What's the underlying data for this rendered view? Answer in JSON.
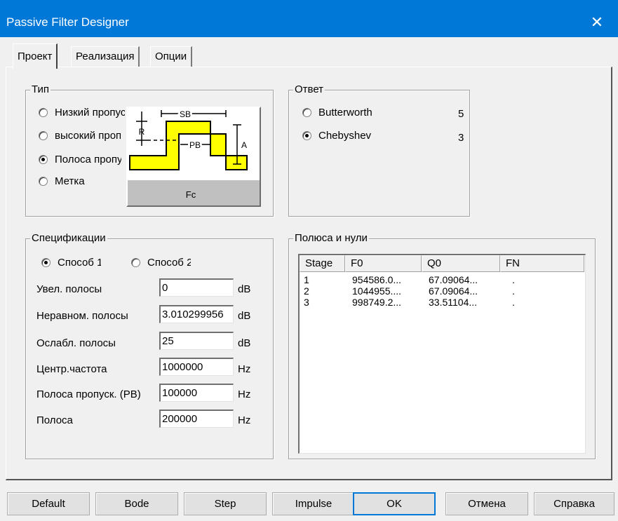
{
  "window": {
    "title": "Passive Filter Designer",
    "close_glyph": "✕"
  },
  "tabs": [
    {
      "label": "Проект"
    },
    {
      "label": "Реализация"
    },
    {
      "label": "Опции"
    }
  ],
  "type_group": {
    "legend": "Тип",
    "options": [
      {
        "label": "Низкий пропуск",
        "selected": false
      },
      {
        "label": "высокий пропуск",
        "selected": false
      },
      {
        "label": "Полоса пропускания",
        "selected": true
      },
      {
        "label": "Метка",
        "selected": false
      }
    ],
    "diagram_labels": {
      "sb": "SB",
      "pb": "PB",
      "r": "R",
      "a": "A",
      "fc": "Fc"
    }
  },
  "response_group": {
    "legend": "Ответ",
    "options": [
      {
        "label": "Butterworth",
        "order": "5",
        "selected": false
      },
      {
        "label": "Chebyshev",
        "order": "3",
        "selected": true
      }
    ]
  },
  "spec_group": {
    "legend": "Спецификации",
    "methods": [
      {
        "label": "Способ 1",
        "selected": true
      },
      {
        "label": "Способ 2",
        "selected": false
      }
    ],
    "fields": [
      {
        "label": "Увел. полосы",
        "value": "0",
        "unit": "dB"
      },
      {
        "label": "Неравном. полосы",
        "value": "3.010299956",
        "unit": "dB"
      },
      {
        "label": "Ослабл. полосы",
        "value": "25",
        "unit": "dB"
      },
      {
        "label": "Центр.частота",
        "value": "1000000",
        "unit": "Hz"
      },
      {
        "label": "Полоса пропуск. (PB)",
        "value": "100000",
        "unit": "Hz"
      },
      {
        "label": "Полоса",
        "value": "200000",
        "unit": "Hz"
      }
    ]
  },
  "poles_group": {
    "legend": "Полюса и нули",
    "columns": [
      "Stage",
      "F0",
      "Q0",
      "FN"
    ],
    "rows": [
      {
        "stage": "1",
        "f0": "954586.0...",
        "q0": "67.09064...",
        "fn": "."
      },
      {
        "stage": "2",
        "f0": "1044955....",
        "q0": "67.09064...",
        "fn": "."
      },
      {
        "stage": "3",
        "f0": "998749.2...",
        "q0": "33.51104...",
        "fn": "."
      }
    ]
  },
  "buttons": {
    "default": "Default",
    "bode": "Bode",
    "step": "Step",
    "impulse": "Impulse",
    "ok": "OK",
    "cancel": "Отмена",
    "help": "Справка"
  },
  "colors": {
    "titlebar": "#0078d7",
    "filter_fill": "#ffff00",
    "dialog_bg": "#f0f0f0"
  }
}
